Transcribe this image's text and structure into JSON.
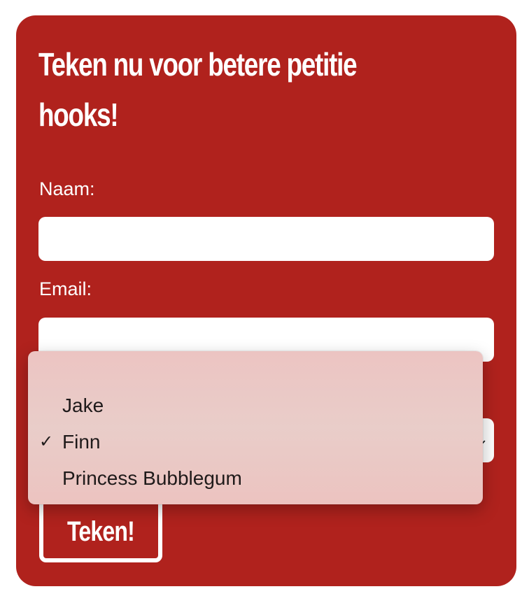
{
  "form": {
    "heading": "Teken nu voor betere petitie hooks!",
    "name_label": "Naam:",
    "name_value": "",
    "email_label": "Email:",
    "email_value": "",
    "select_selected": "Finn",
    "submit_label": "Teken!"
  },
  "dropdown": {
    "options": [
      {
        "label": "Jake",
        "selected": false
      },
      {
        "label": "Finn",
        "selected": true
      },
      {
        "label": "Princess Bubblegum",
        "selected": false
      }
    ],
    "check_glyph": "✓"
  },
  "colors": {
    "card_background": "#b0221d",
    "text": "#ffffff",
    "dropdown_background": "#e9cdc9"
  },
  "icons": {
    "select_chevron": "chevron-down-icon",
    "selected_check": "checkmark-icon"
  }
}
